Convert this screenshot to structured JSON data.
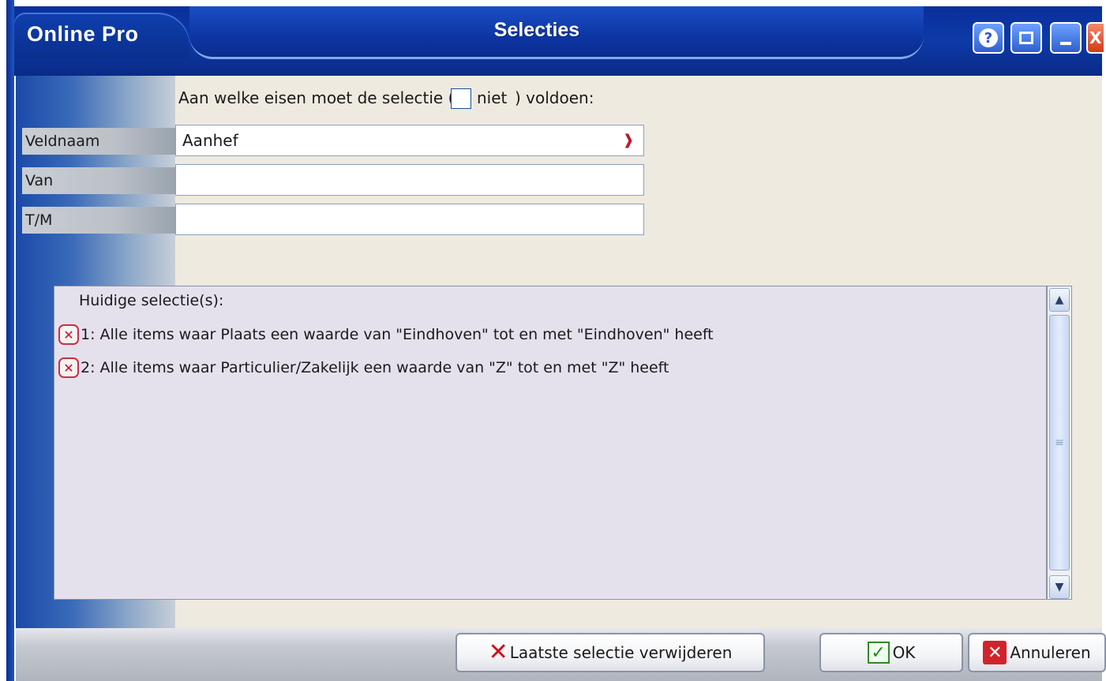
{
  "titlebar": {
    "app_name": "Online Pro",
    "dialog_title": "Selecties"
  },
  "form": {
    "question_prefix": "Aan welke eisen moet de selectie (",
    "niet_label": "niet",
    "question_suffix": ") voldoen:",
    "niet_checked": false,
    "fields": [
      {
        "label": "Veldnaam",
        "value": "Aanhef",
        "type": "dropdown"
      },
      {
        "label": "Van",
        "value": "",
        "type": "text"
      },
      {
        "label": "T/M",
        "value": "",
        "type": "text"
      }
    ]
  },
  "selections": {
    "header": "Huidige selectie(s):",
    "items": [
      "1: Alle items waar Plaats een waarde van \"Eindhoven\" tot en met \"Eindhoven\" heeft",
      "2: Alle items waar Particulier/Zakelijk een waarde van \"Z\" tot en met \"Z\" heeft"
    ]
  },
  "buttons": {
    "remove_last": "Laatste selectie verwijderen",
    "ok": "OK",
    "cancel": "Annuleren"
  },
  "icons": {
    "help": "help-icon",
    "restore": "restore-icon",
    "minimize": "minimize-icon",
    "close": "close-icon",
    "remove_item": "remove-x-icon",
    "dropdown": "chevron-down-icon",
    "ok": "checkmark-icon",
    "cancel": "cancel-icon"
  },
  "colors": {
    "titlebar_blue": "#0d3aa8",
    "content_bg": "#eeeae0",
    "list_bg": "#e5e1ec",
    "accent_red": "#d0101a",
    "accent_green": "#1c8c1c"
  }
}
